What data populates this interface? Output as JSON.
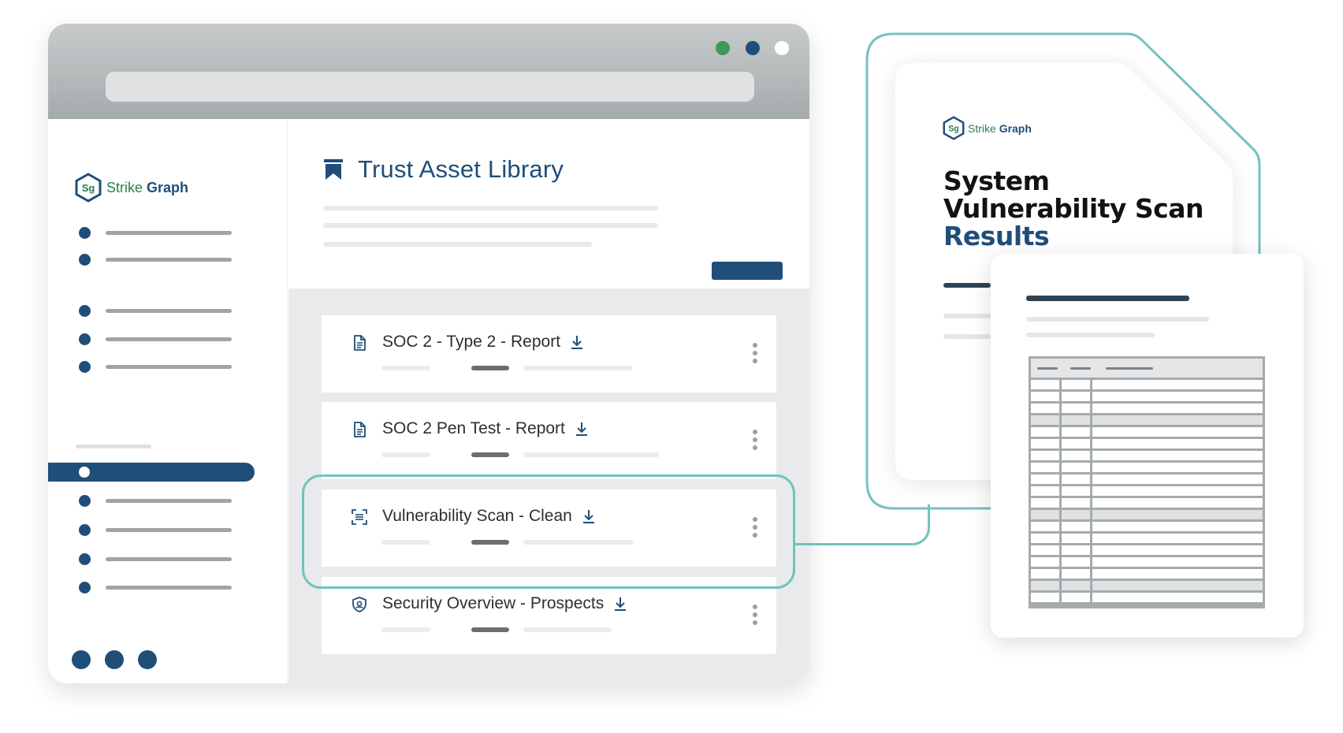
{
  "brand": {
    "logo_mark": "Sg",
    "name_part1": "Strike",
    "name_part2": "Graph",
    "primary_color": "#1f4e79",
    "logo_green": "#2e7d4f",
    "accent_teal": "#72c3ba"
  },
  "window": {
    "controls": [
      {
        "name": "green-dot",
        "color": "#3f9a5a"
      },
      {
        "name": "blue-dot",
        "color": "#1f4e79"
      },
      {
        "name": "white-dot",
        "color": "#ffffff"
      }
    ]
  },
  "library": {
    "title": "Trust Asset Library",
    "title_icon": "bookmark-icon",
    "items": [
      {
        "icon": "document-icon",
        "title": "SOC 2 - Type 2 - Report",
        "action_icon": "download-icon",
        "menu_icon": "kebab-menu-icon"
      },
      {
        "icon": "document-icon",
        "title": "SOC 2 Pen Test - Report",
        "action_icon": "download-icon",
        "menu_icon": "kebab-menu-icon"
      },
      {
        "icon": "scan-icon",
        "title": "Vulnerability Scan - Clean",
        "action_icon": "download-icon",
        "menu_icon": "kebab-menu-icon",
        "highlighted": true
      },
      {
        "icon": "shield-icon",
        "title": "Security Overview - Prospects",
        "action_icon": "download-icon",
        "menu_icon": "kebab-menu-icon"
      }
    ]
  },
  "report": {
    "title_line1": "System",
    "title_line2": "Vulnerability Scan",
    "title_line3": "Results"
  }
}
